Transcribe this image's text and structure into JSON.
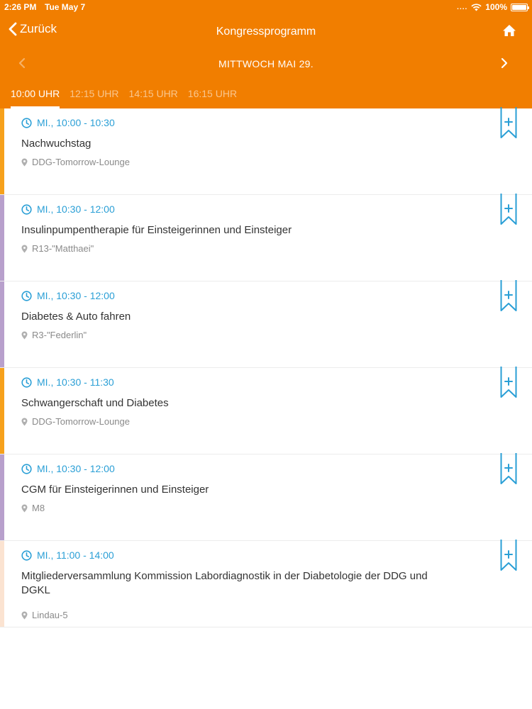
{
  "status_bar": {
    "time": "2:26 PM",
    "date": "Tue May 7",
    "signal": "....",
    "battery_percent": "100%"
  },
  "nav": {
    "back_label": "Zurück",
    "title": "Kongressprogramm",
    "home_icon": "home-icon"
  },
  "date_nav": {
    "label": "MITTWOCH MAI 29."
  },
  "time_tabs": [
    "10:00 UHR",
    "12:15 UHR",
    "14:15 UHR",
    "16:15 UHR"
  ],
  "active_tab": 0,
  "colors": {
    "header": "#f17e00",
    "time_text": "#2a9fd6",
    "stripe_orange": "#f6a11c",
    "stripe_purple": "#b8a0cc",
    "stripe_peach": "#fbe3d1"
  },
  "sessions": [
    {
      "time": "MI., 10:00 - 10:30",
      "title": "Nachwuchstag",
      "location": "DDG-Tomorrow-Lounge",
      "stripe": "#f6a11c"
    },
    {
      "time": "MI., 10:30 - 12:00",
      "title": "Insulinpumpentherapie für Einsteigerinnen und Einsteiger",
      "location": "R13-\"Matthaei\"",
      "stripe": "#b8a0cc"
    },
    {
      "time": "MI., 10:30 - 12:00",
      "title": "Diabetes & Auto fahren",
      "location": "R3-\"Federlin\"",
      "stripe": "#b8a0cc"
    },
    {
      "time": "MI., 10:30 - 11:30",
      "title": "Schwangerschaft und Diabetes",
      "location": "DDG-Tomorrow-Lounge",
      "stripe": "#f6a11c"
    },
    {
      "time": "MI., 10:30 - 12:00",
      "title": "CGM für Einsteigerinnen und Einsteiger",
      "location": "M8",
      "stripe": "#b8a0cc"
    },
    {
      "time": "MI., 11:00 - 14:00",
      "title": "Mitgliederversammlung Kommission Labordiagnostik in der Diabetologie der DDG und DGKL",
      "location": "Lindau-5",
      "stripe": "#fbe3d1"
    }
  ]
}
